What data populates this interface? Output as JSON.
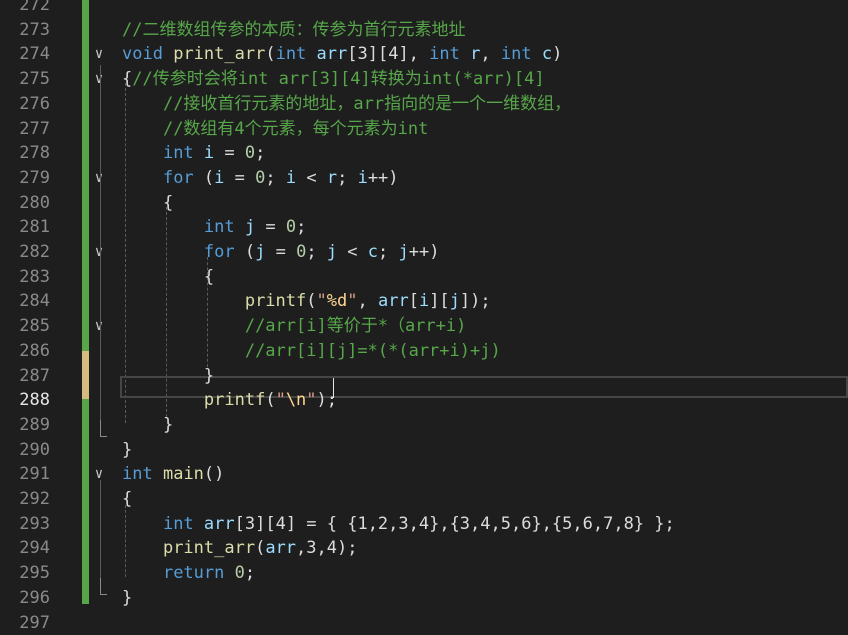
{
  "editor": {
    "line_numbers": [
      "272",
      "273",
      "274",
      "275",
      "276",
      "277",
      "278",
      "279",
      "280",
      "281",
      "282",
      "283",
      "284",
      "285",
      "286",
      "287",
      "288",
      "289",
      "290",
      "291",
      "292",
      "293",
      "294",
      "295",
      "296",
      "297"
    ],
    "current_line": "288",
    "lines": {
      "l273": [
        {
          "t": "cm",
          "v": "//二维数组传参的本质：传参为首行元素地址"
        }
      ],
      "l274": [
        {
          "t": "kw",
          "v": "void"
        },
        {
          "t": "pl",
          "v": " "
        },
        {
          "t": "fn",
          "v": "print_arr"
        },
        {
          "t": "pl",
          "v": "("
        },
        {
          "t": "kw",
          "v": "int"
        },
        {
          "t": "pl",
          "v": " "
        },
        {
          "t": "par",
          "v": "arr"
        },
        {
          "t": "pl",
          "v": "[3][4], "
        },
        {
          "t": "kw",
          "v": "int"
        },
        {
          "t": "pl",
          "v": " "
        },
        {
          "t": "par",
          "v": "r"
        },
        {
          "t": "pl",
          "v": ", "
        },
        {
          "t": "kw",
          "v": "int"
        },
        {
          "t": "pl",
          "v": " "
        },
        {
          "t": "par",
          "v": "c"
        },
        {
          "t": "pl",
          "v": ")"
        }
      ],
      "l275": [
        {
          "t": "pl",
          "v": "{"
        },
        {
          "t": "cm",
          "v": "//传参时会将int arr[3][4]转换为int(*arr)[4]"
        }
      ],
      "l276": [
        {
          "t": "pl",
          "v": "    "
        },
        {
          "t": "cm",
          "v": "//接收首行元素的地址，arr指向的是一个一维数组，"
        }
      ],
      "l277": [
        {
          "t": "pl",
          "v": "    "
        },
        {
          "t": "cm",
          "v": "//数组有4个元素，每个元素为int"
        }
      ],
      "l278": [
        {
          "t": "pl",
          "v": "    "
        },
        {
          "t": "kw",
          "v": "int"
        },
        {
          "t": "pl",
          "v": " "
        },
        {
          "t": "var",
          "v": "i"
        },
        {
          "t": "pl",
          "v": " = "
        },
        {
          "t": "num",
          "v": "0"
        },
        {
          "t": "pl",
          "v": ";"
        }
      ],
      "l279": [
        {
          "t": "pl",
          "v": "    "
        },
        {
          "t": "kw",
          "v": "for"
        },
        {
          "t": "pl",
          "v": " ("
        },
        {
          "t": "var",
          "v": "i"
        },
        {
          "t": "pl",
          "v": " = "
        },
        {
          "t": "num",
          "v": "0"
        },
        {
          "t": "pl",
          "v": "; "
        },
        {
          "t": "var",
          "v": "i"
        },
        {
          "t": "pl",
          "v": " < "
        },
        {
          "t": "par",
          "v": "r"
        },
        {
          "t": "pl",
          "v": "; "
        },
        {
          "t": "var",
          "v": "i"
        },
        {
          "t": "pl",
          "v": "++)"
        }
      ],
      "l280": [
        {
          "t": "pl",
          "v": "    {"
        }
      ],
      "l281": [
        {
          "t": "pl",
          "v": "        "
        },
        {
          "t": "kw",
          "v": "int"
        },
        {
          "t": "pl",
          "v": " "
        },
        {
          "t": "var",
          "v": "j"
        },
        {
          "t": "pl",
          "v": " = "
        },
        {
          "t": "num",
          "v": "0"
        },
        {
          "t": "pl",
          "v": ";"
        }
      ],
      "l282": [
        {
          "t": "pl",
          "v": "        "
        },
        {
          "t": "kw",
          "v": "for"
        },
        {
          "t": "pl",
          "v": " ("
        },
        {
          "t": "var",
          "v": "j"
        },
        {
          "t": "pl",
          "v": " = "
        },
        {
          "t": "num",
          "v": "0"
        },
        {
          "t": "pl",
          "v": "; "
        },
        {
          "t": "var",
          "v": "j"
        },
        {
          "t": "pl",
          "v": " < "
        },
        {
          "t": "par",
          "v": "c"
        },
        {
          "t": "pl",
          "v": "; "
        },
        {
          "t": "var",
          "v": "j"
        },
        {
          "t": "pl",
          "v": "++)"
        }
      ],
      "l283": [
        {
          "t": "pl",
          "v": "        {"
        }
      ],
      "l284": [
        {
          "t": "pl",
          "v": "            "
        },
        {
          "t": "fn",
          "v": "printf"
        },
        {
          "t": "pl",
          "v": "("
        },
        {
          "t": "str",
          "v": "\""
        },
        {
          "t": "esc",
          "v": "%d"
        },
        {
          "t": "str",
          "v": "\""
        },
        {
          "t": "pl",
          "v": ", "
        },
        {
          "t": "par",
          "v": "arr"
        },
        {
          "t": "pl",
          "v": "["
        },
        {
          "t": "var",
          "v": "i"
        },
        {
          "t": "pl",
          "v": "]["
        },
        {
          "t": "var",
          "v": "j"
        },
        {
          "t": "pl",
          "v": "]);"
        }
      ],
      "l285": [
        {
          "t": "pl",
          "v": "            "
        },
        {
          "t": "cm",
          "v": "//arr[i]等价于*（arr+i)"
        }
      ],
      "l286": [
        {
          "t": "pl",
          "v": "            "
        },
        {
          "t": "cm",
          "v": "//arr[i][j]=*(*(arr+i)+j)"
        }
      ],
      "l287": [
        {
          "t": "pl",
          "v": "        }"
        }
      ],
      "l288": [
        {
          "t": "pl",
          "v": "        "
        },
        {
          "t": "fn",
          "v": "printf"
        },
        {
          "t": "pl",
          "v": "("
        },
        {
          "t": "str",
          "v": "\""
        },
        {
          "t": "esc",
          "v": "\\n"
        },
        {
          "t": "str",
          "v": "\""
        },
        {
          "t": "pl",
          "v": ");"
        }
      ],
      "l289": [
        {
          "t": "pl",
          "v": "    }"
        }
      ],
      "l290": [
        {
          "t": "pl",
          "v": "}"
        }
      ],
      "l291": [
        {
          "t": "kw",
          "v": "int"
        },
        {
          "t": "pl",
          "v": " "
        },
        {
          "t": "fn",
          "v": "main"
        },
        {
          "t": "pl",
          "v": "()"
        }
      ],
      "l292": [
        {
          "t": "pl",
          "v": "{"
        }
      ],
      "l293": [
        {
          "t": "pl",
          "v": "    "
        },
        {
          "t": "kw",
          "v": "int"
        },
        {
          "t": "pl",
          "v": " "
        },
        {
          "t": "var",
          "v": "arr"
        },
        {
          "t": "pl",
          "v": "[3][4] = { {1,2,3,4},{3,4,5,6},{5,6,7,8} };"
        }
      ],
      "l294": [
        {
          "t": "pl",
          "v": "    "
        },
        {
          "t": "fn",
          "v": "print_arr"
        },
        {
          "t": "pl",
          "v": "("
        },
        {
          "t": "var",
          "v": "arr"
        },
        {
          "t": "pl",
          "v": ",3,4);"
        }
      ],
      "l295": [
        {
          "t": "pl",
          "v": "    "
        },
        {
          "t": "kw",
          "v": "return"
        },
        {
          "t": "pl",
          "v": " "
        },
        {
          "t": "num",
          "v": "0"
        },
        {
          "t": "pl",
          "v": ";"
        }
      ],
      "l296": [
        {
          "t": "pl",
          "v": "}"
        }
      ]
    },
    "fold_lines": [
      "274",
      "275",
      "279",
      "282",
      "285",
      "291"
    ],
    "fold_glyph": "∨",
    "colors": {
      "background": "#1e1e1e",
      "keyword": "#569cd6",
      "comment": "#57a64a",
      "function": "#dcdcaa",
      "string": "#d69d85",
      "number": "#b5cea8",
      "variable": "#9cdcfe",
      "change_saved": "#57a64a",
      "change_unsaved": "#d7ba7d"
    }
  }
}
